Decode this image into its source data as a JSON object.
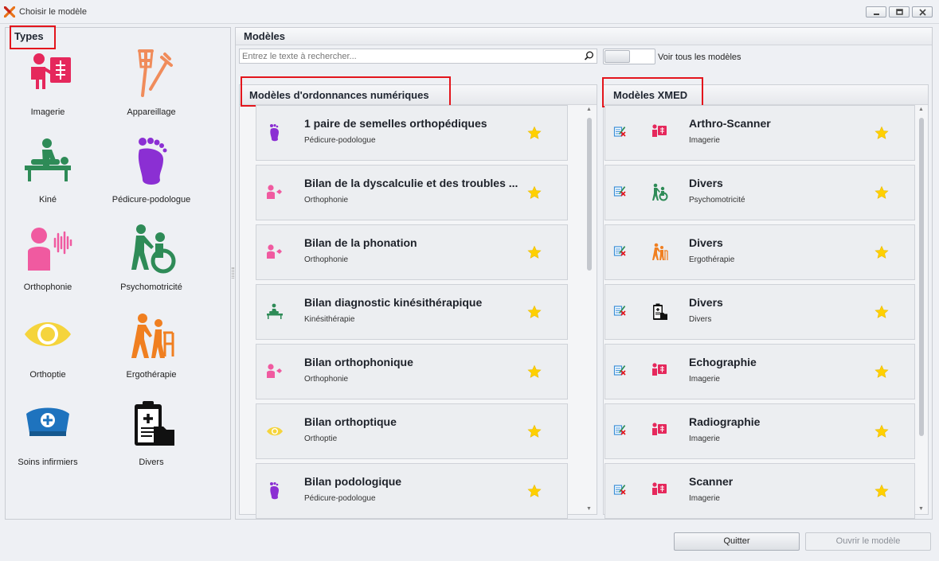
{
  "window": {
    "title": "Choisir le modèle"
  },
  "types": {
    "header": "Types",
    "items": [
      {
        "label": "Imagerie",
        "icon": "imaging-icon"
      },
      {
        "label": "Appareillage",
        "icon": "crutches-icon"
      },
      {
        "label": "Kiné",
        "icon": "physiotherapy-icon"
      },
      {
        "label": "Pédicure-podologue",
        "icon": "foot-icon"
      },
      {
        "label": "Orthophonie",
        "icon": "speech-icon"
      },
      {
        "label": "Psychomotricité",
        "icon": "psychomotor-icon"
      },
      {
        "label": "Orthoptie",
        "icon": "eye-icon"
      },
      {
        "label": "Ergothérapie",
        "icon": "walker-icon"
      },
      {
        "label": "Soins infirmiers",
        "icon": "nurse-cap-icon"
      },
      {
        "label": "Divers",
        "icon": "clipboard-medical-icon"
      }
    ]
  },
  "models": {
    "header": "Modèles",
    "search_placeholder": "Entrez le texte à rechercher...",
    "toggle_label": "Voir tous les modèles",
    "digital": {
      "header": "Modèles d'ordonnances numériques",
      "items": [
        {
          "title": "1 paire de semelles orthopédiques",
          "category": "Pédicure-podologue",
          "icon": "foot-icon"
        },
        {
          "title": "Bilan de la dyscalculie et des troubles ...",
          "category": "Orthophonie",
          "icon": "speech-icon"
        },
        {
          "title": "Bilan de la phonation",
          "category": "Orthophonie",
          "icon": "speech-icon"
        },
        {
          "title": "Bilan diagnostic kinésithérapique",
          "category": "Kinésithérapie",
          "icon": "physiotherapy-icon"
        },
        {
          "title": "Bilan orthophonique",
          "category": "Orthophonie",
          "icon": "speech-icon"
        },
        {
          "title": "Bilan orthoptique",
          "category": "Orthoptie",
          "icon": "eye-icon"
        },
        {
          "title": "Bilan podologique",
          "category": "Pédicure-podologue",
          "icon": "foot-icon"
        }
      ]
    },
    "xmed": {
      "header": "Modèles XMED",
      "items": [
        {
          "title": "Arthro-Scanner",
          "category": "Imagerie",
          "icon": "imaging-icon"
        },
        {
          "title": "Divers",
          "category": "Psychomotricité",
          "icon": "psychomotor-icon"
        },
        {
          "title": "Divers",
          "category": "Ergothérapie",
          "icon": "walker-icon"
        },
        {
          "title": "Divers",
          "category": "Divers",
          "icon": "clipboard-medical-icon"
        },
        {
          "title": "Echographie",
          "category": "Imagerie",
          "icon": "imaging-icon"
        },
        {
          "title": "Radiographie",
          "category": "Imagerie",
          "icon": "imaging-icon"
        },
        {
          "title": "Scanner",
          "category": "Imagerie",
          "icon": "imaging-icon"
        }
      ]
    }
  },
  "buttons": {
    "quit": "Quitter",
    "open": "Ouvrir le modèle"
  },
  "colors": {
    "imaging": "#e5285c",
    "crutches": "#f08c5b",
    "physio": "#2e8b57",
    "foot": "#8b2fd3",
    "speech": "#f05aa0",
    "psycho": "#2e8b57",
    "eye": "#f5d43c",
    "ergo": "#f07f20",
    "nurse": "#1e73be",
    "misc": "#111111",
    "star": "#ffd000",
    "highlight": "#e3151c"
  }
}
